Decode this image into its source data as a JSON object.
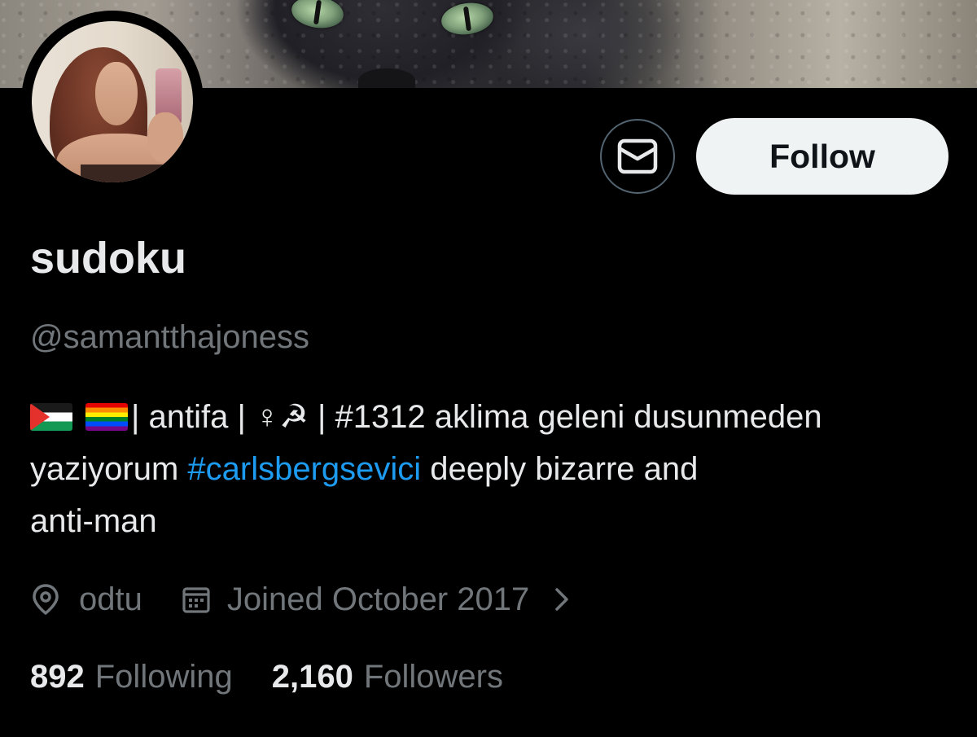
{
  "profile": {
    "display_name": "sudoku",
    "handle": "@samantthajoness",
    "bio": {
      "line1_text": "| antifa | ♀☭ | #1312 aklima geleni dusunmeden",
      "line2_prefix": "yaziyorum ",
      "line2_hashtag": "#carlsbergsevici",
      "line2_suffix": " deeply bizarre and",
      "line3": "anti-man",
      "emoji": [
        "palestine-flag",
        "rainbow-flag"
      ]
    },
    "location": "odtu",
    "joined": "Joined October 2017",
    "following_count": "892",
    "following_label": "Following",
    "followers_count": "2,160",
    "followers_label": "Followers"
  },
  "actions": {
    "follow_label": "Follow",
    "message_icon": "envelope-icon"
  },
  "icons": {
    "location": "map-pin-icon",
    "joined": "calendar-icon",
    "expand": "chevron-right-icon"
  },
  "colors": {
    "background": "#000000",
    "primary_text": "#e7e9ea",
    "secondary_text": "#71767b",
    "link": "#1d9bf0",
    "follow_button_bg": "#eff3f4",
    "follow_button_text": "#0f1419",
    "outline": "#536471"
  }
}
